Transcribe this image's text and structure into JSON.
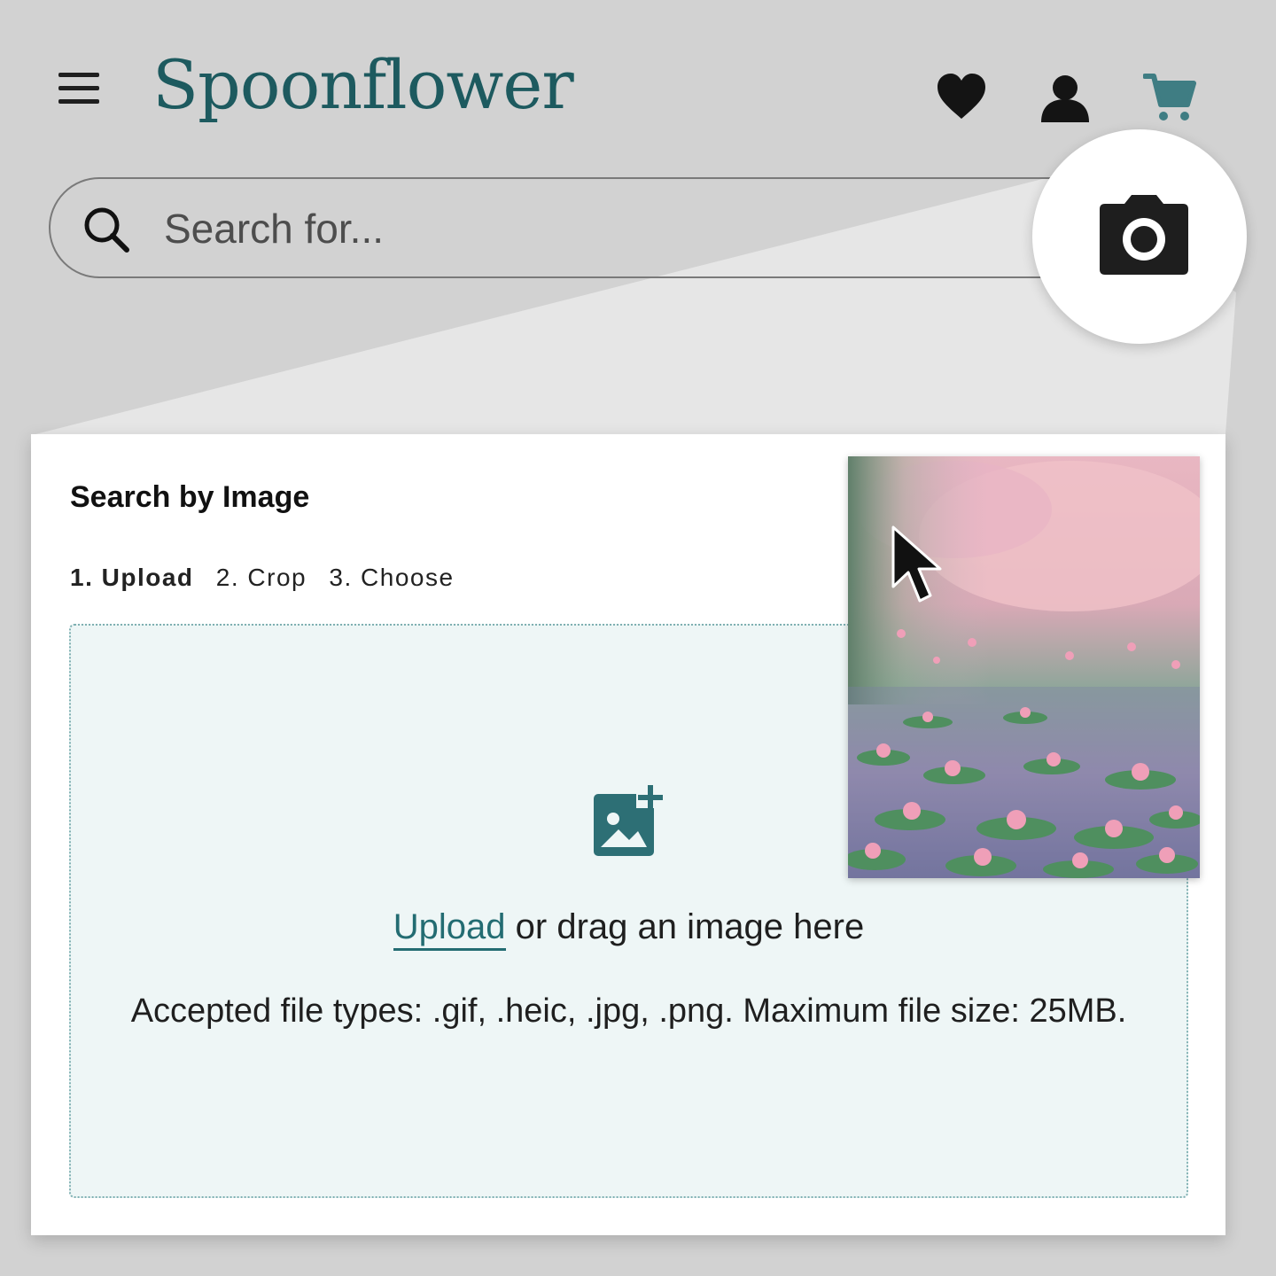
{
  "header": {
    "logo": "Spoonflower",
    "menu_icon": "hamburger-menu-icon",
    "icons": [
      "heart-icon",
      "user-icon",
      "cart-icon"
    ]
  },
  "search": {
    "placeholder": "Search for...",
    "camera_icon": "camera-icon"
  },
  "panel": {
    "title": "Search by Image",
    "steps": [
      "1. Upload",
      "2. Crop",
      "3. Choose"
    ],
    "active_step": 0,
    "upload_link": "Upload",
    "upload_rest": " or drag an image here",
    "file_types": "Accepted file types: .gif, .heic, .jpg, .png. Maximum file size: 25MB."
  },
  "colors": {
    "brand": "#1d5a5f",
    "accent": "#236c72",
    "dropzone_bg": "#eef6f6",
    "page_bg": "#d2d2d2"
  }
}
